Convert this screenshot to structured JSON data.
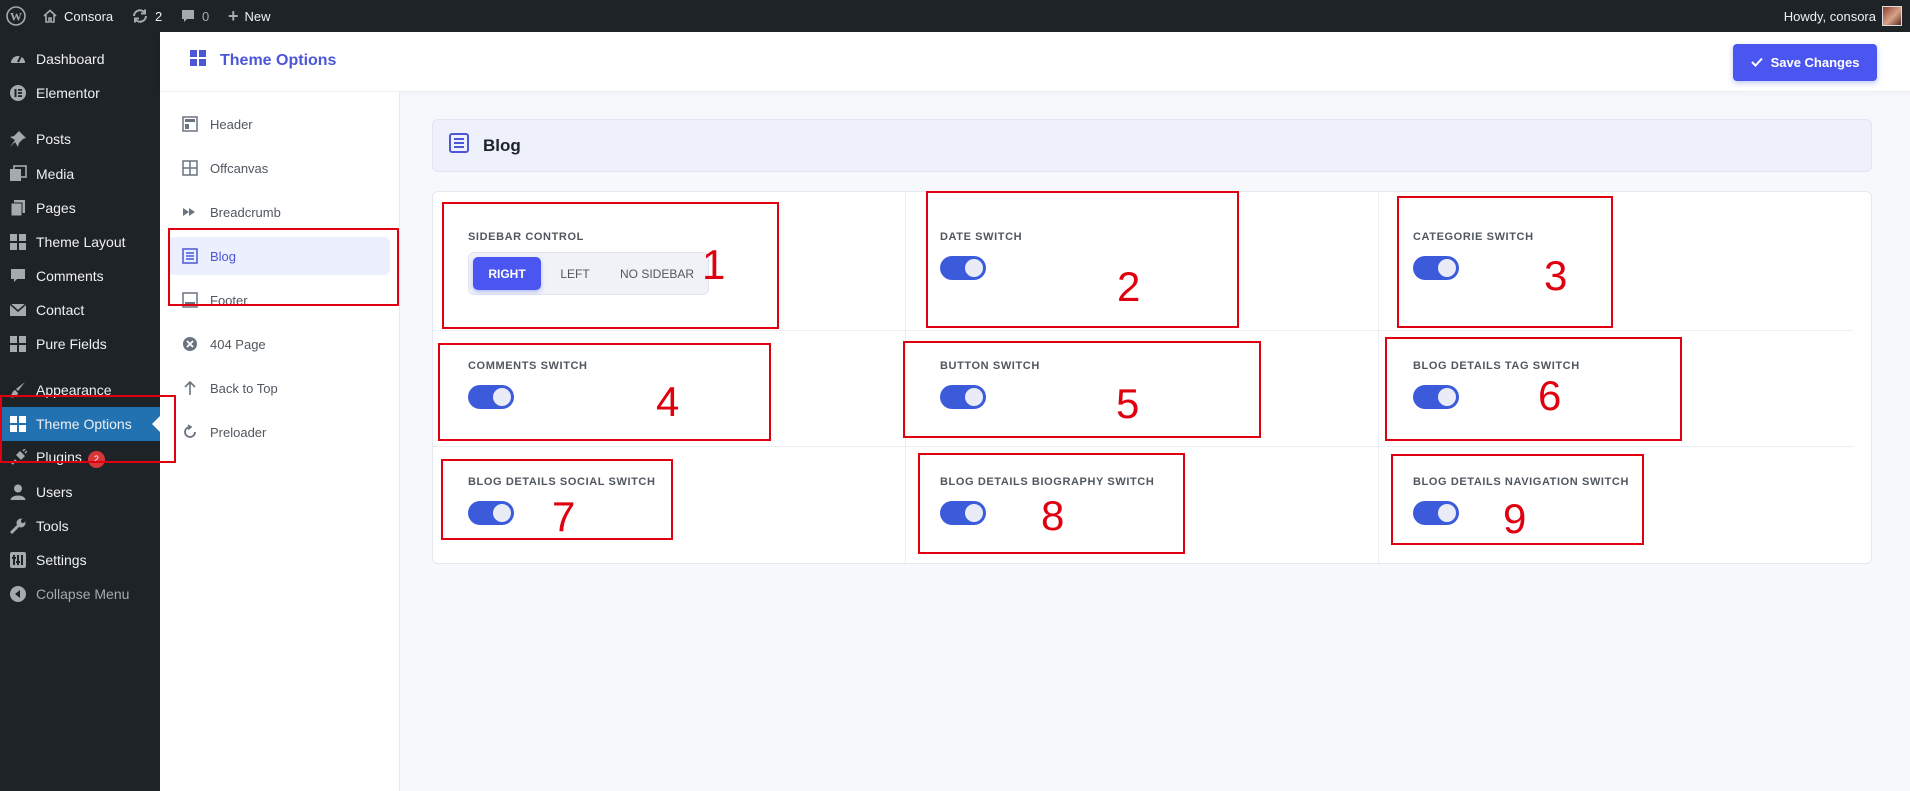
{
  "admin_bar": {
    "site_name": "Consora",
    "updates_count": "2",
    "comments_count": "0",
    "new_label": "New",
    "howdy": "Howdy, consora"
  },
  "admin_menu": {
    "items": [
      {
        "label": "Dashboard",
        "icon": "dashboard-icon"
      },
      {
        "label": "Elementor",
        "icon": "elementor-icon"
      },
      {
        "label": "Posts",
        "icon": "pin-icon"
      },
      {
        "label": "Media",
        "icon": "media-icon"
      },
      {
        "label": "Pages",
        "icon": "pages-icon"
      },
      {
        "label": "Theme Layout",
        "icon": "grid-icon"
      },
      {
        "label": "Comments",
        "icon": "comment-icon"
      },
      {
        "label": "Contact",
        "icon": "mail-icon"
      },
      {
        "label": "Pure Fields",
        "icon": "grid-icon"
      },
      {
        "label": "Appearance",
        "icon": "brush-icon"
      },
      {
        "label": "Theme Options",
        "icon": "grid-icon"
      },
      {
        "label": "Plugins",
        "icon": "plugin-icon",
        "badge": "2"
      },
      {
        "label": "Users",
        "icon": "user-icon"
      },
      {
        "label": "Tools",
        "icon": "wrench-icon"
      },
      {
        "label": "Settings",
        "icon": "settings-icon"
      },
      {
        "label": "Collapse Menu",
        "icon": "collapse-icon"
      }
    ]
  },
  "topbar": {
    "title": "Theme Options",
    "save_label": "Save Changes"
  },
  "subnav": {
    "items": [
      {
        "label": "Header",
        "icon": "header-icon"
      },
      {
        "label": "Offcanvas",
        "icon": "offcanvas-icon"
      },
      {
        "label": "Breadcrumb",
        "icon": "breadcrumb-icon"
      },
      {
        "label": "Blog",
        "icon": "list-icon"
      },
      {
        "label": "Footer",
        "icon": "footer-icon"
      },
      {
        "label": "404 Page",
        "icon": "error-icon"
      },
      {
        "label": "Back to Top",
        "icon": "arrow-up-icon"
      },
      {
        "label": "Preloader",
        "icon": "reload-icon"
      }
    ]
  },
  "section": {
    "title": "Blog"
  },
  "options": {
    "sidebar_control": {
      "label": "SIDEBAR CONTROL",
      "choices": [
        "RIGHT",
        "LEFT",
        "NO SIDEBAR"
      ],
      "selected": "RIGHT"
    },
    "date_switch": {
      "label": "DATE SWITCH",
      "on": true
    },
    "categorie_switch": {
      "label": "CATEGORIE SWITCH",
      "on": true
    },
    "comments_switch": {
      "label": "COMMENTS SWITCH",
      "on": true
    },
    "button_switch": {
      "label": "BUTTON SWITCH",
      "on": true
    },
    "tag_switch": {
      "label": "BLOG DETAILS TAG SWITCH",
      "on": true
    },
    "social_switch": {
      "label": "BLOG DETAILS SOCIAL SWITCH",
      "on": true
    },
    "biography_switch": {
      "label": "BLOG DETAILS BIOGRAPHY SWITCH",
      "on": true
    },
    "navigation_switch": {
      "label": "BLOG DETAILS NAVIGATION SWITCH",
      "on": true
    }
  },
  "annotations": [
    "1",
    "2",
    "3",
    "4",
    "5",
    "6",
    "7",
    "8",
    "9"
  ],
  "colors": {
    "accent": "#4b56f1",
    "toggle_on": "#3b5bdb",
    "annotation": "#e0000f",
    "admin_bg": "#1d2327",
    "menu_current": "#2271b1"
  }
}
